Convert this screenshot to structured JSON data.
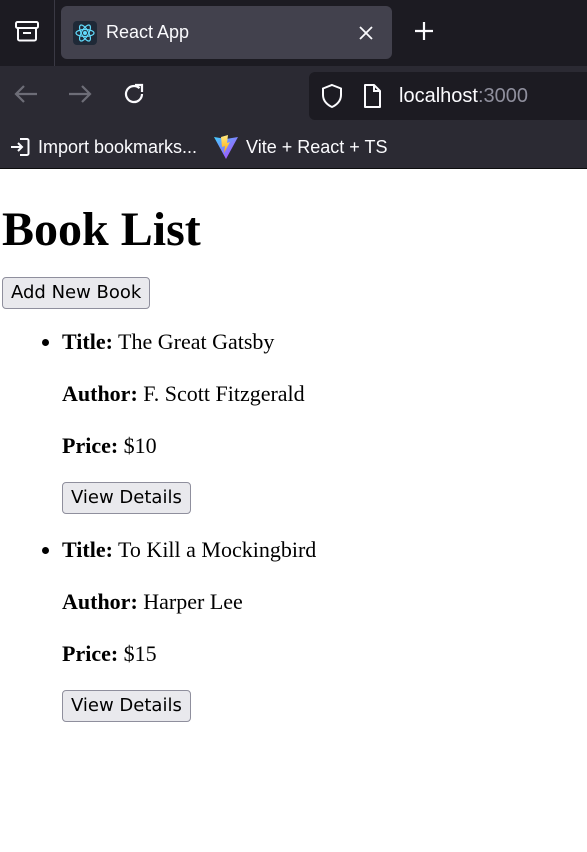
{
  "browser": {
    "tab_title": "React App",
    "url_host": "localhost",
    "url_port": ":3000",
    "bookmarks": [
      {
        "label": "Import bookmarks...",
        "icon": "import-icon"
      },
      {
        "label": "Vite + React + TS",
        "icon": "vite-icon"
      }
    ],
    "colors": {
      "tabbar": "#1c1b22",
      "toolbar": "#2b2a33",
      "active_tab": "#42414d"
    }
  },
  "page": {
    "heading": "Book List",
    "add_button_label": "Add New Book",
    "labels": {
      "title": "Title:",
      "author": "Author:",
      "price": "Price:"
    },
    "details_button_label": "View Details",
    "books": [
      {
        "title": "The Great Gatsby",
        "author": "F. Scott Fitzgerald",
        "price": "$10"
      },
      {
        "title": "To Kill a Mockingbird",
        "author": "Harper Lee",
        "price": "$15"
      }
    ]
  }
}
